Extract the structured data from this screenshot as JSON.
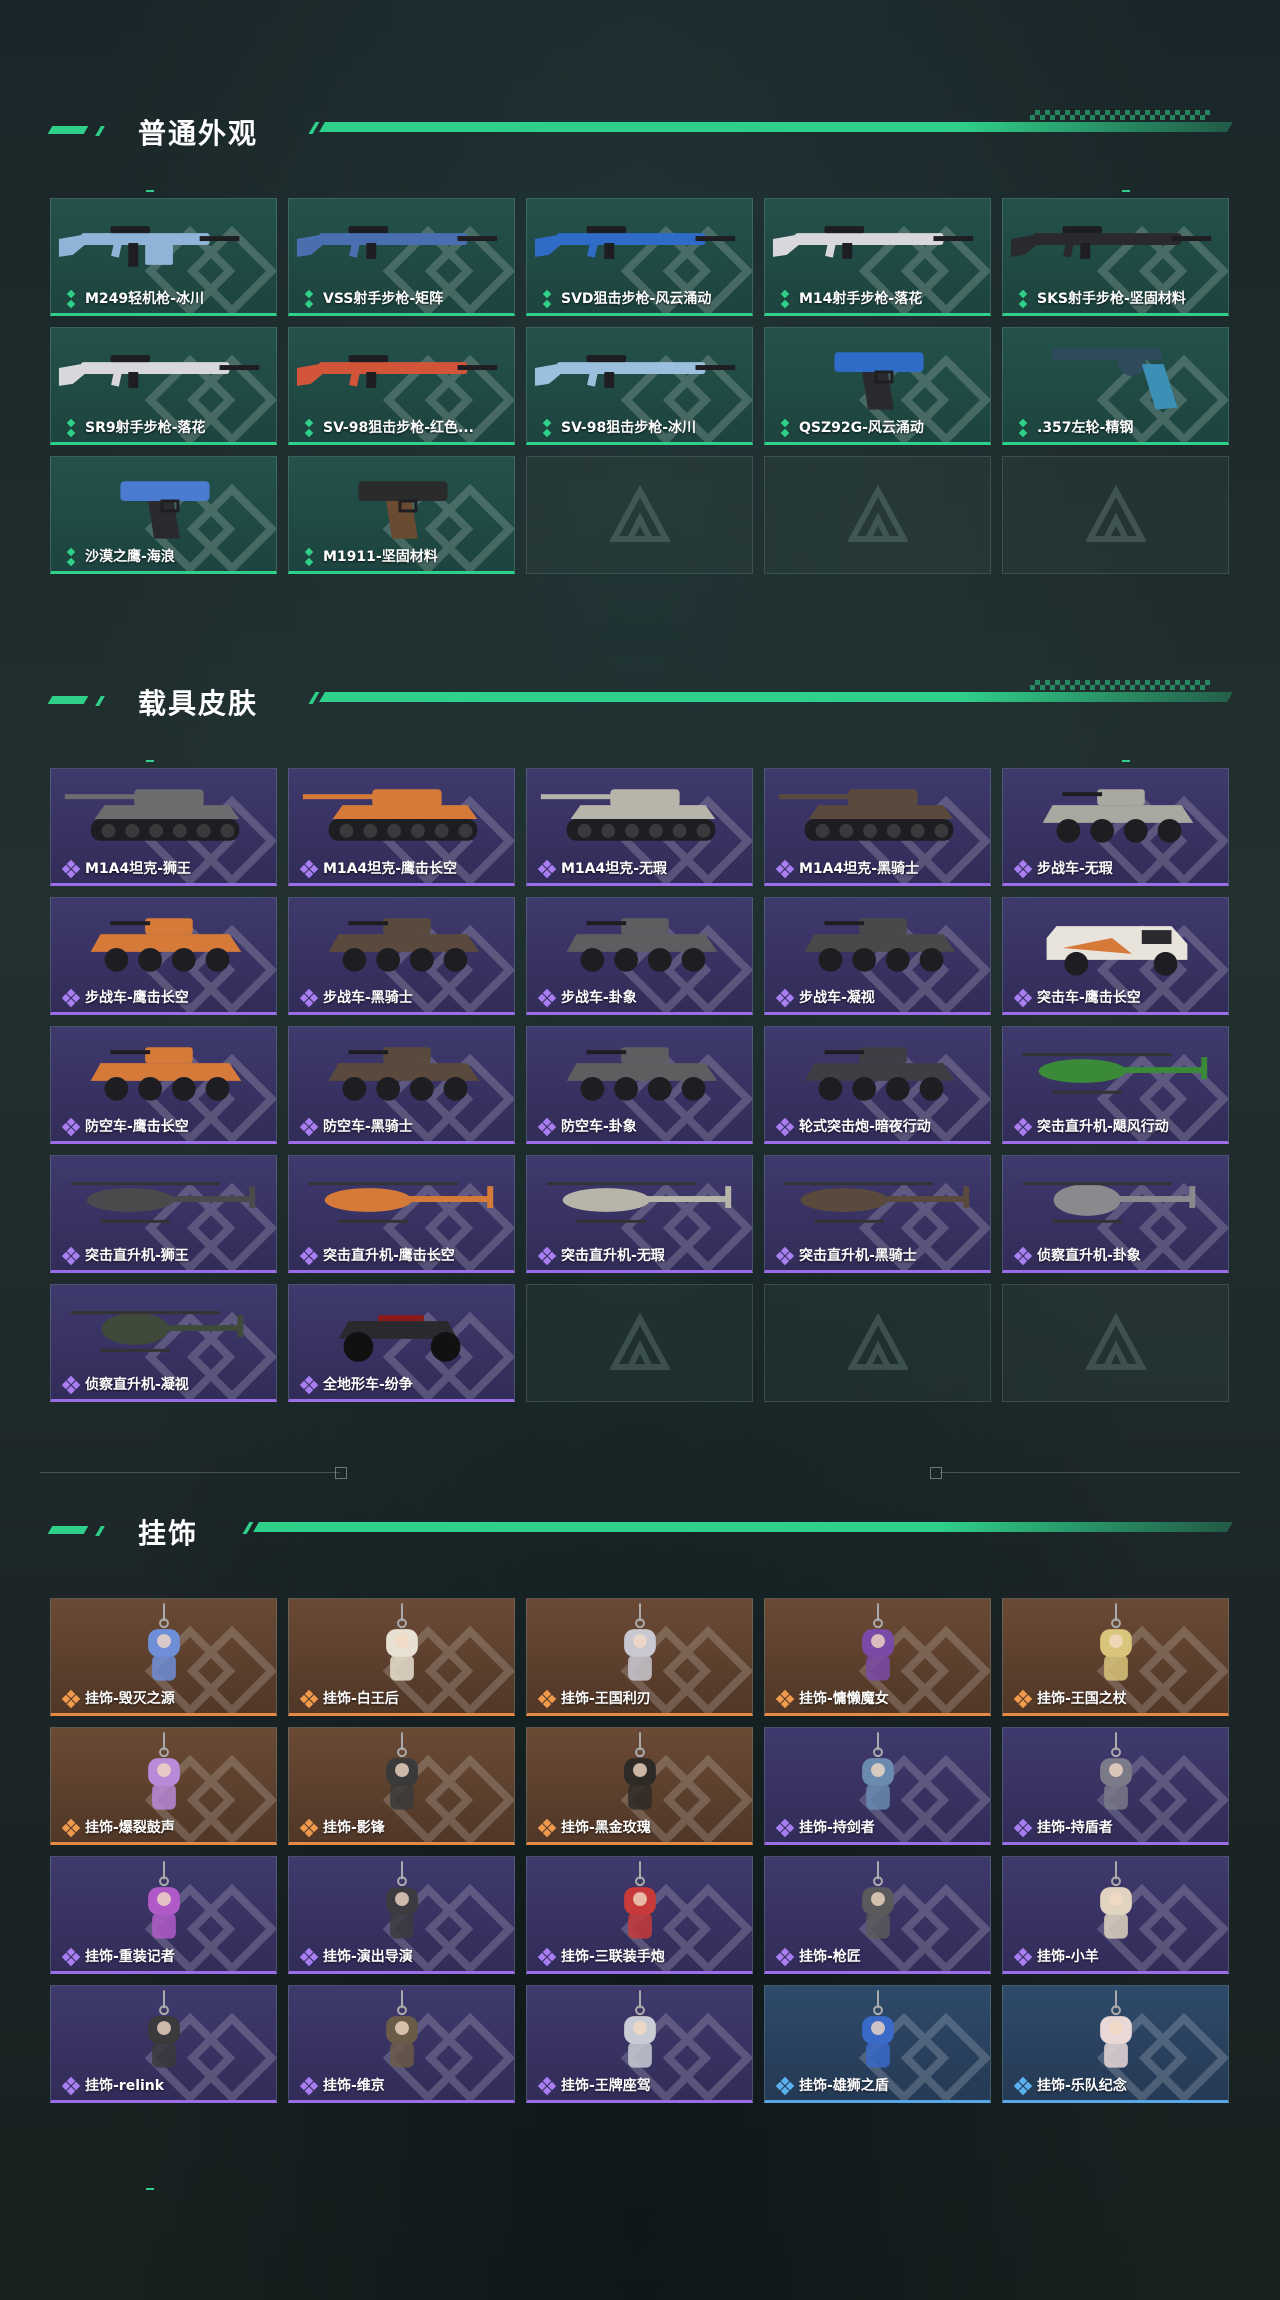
{
  "sections": {
    "weapons": {
      "title": "普通外观",
      "items": [
        {
          "label": "M249轻机枪-冰川",
          "rarity": "green",
          "kind": "rifle-lmg",
          "color": "#8fb4d8"
        },
        {
          "label": "VSS射手步枪-矩阵",
          "rarity": "green",
          "kind": "rifle-vss",
          "color": "#4a6fb0"
        },
        {
          "label": "SVD狙击步枪-风云涌动",
          "rarity": "green",
          "kind": "rifle-long",
          "color": "#2f6cc8"
        },
        {
          "label": "M14射手步枪-落花",
          "rarity": "green",
          "kind": "rifle-long",
          "color": "#d8d8dc"
        },
        {
          "label": "SKS射手步枪-坚固材料",
          "rarity": "green",
          "kind": "rifle-long",
          "color": "#2a2a2e"
        },
        {
          "label": "SR9射手步枪-落花",
          "rarity": "green",
          "kind": "rifle-bullpup",
          "color": "#d8d8dc"
        },
        {
          "label": "SV-98狙击步枪-红色...",
          "rarity": "green",
          "kind": "rifle-long",
          "color": "#d2553a"
        },
        {
          "label": "SV-98狙击步枪-冰川",
          "rarity": "green",
          "kind": "rifle-long",
          "color": "#9bc0de"
        },
        {
          "label": "QSZ92G-风云涌动",
          "rarity": "green",
          "kind": "pistol",
          "color": "#2f6cc8"
        },
        {
          "label": ".357左轮-精钢",
          "rarity": "green",
          "kind": "revolver",
          "color": "#3c8fb5"
        },
        {
          "label": "沙漠之鹰-海浪",
          "rarity": "green",
          "kind": "pistol",
          "color": "#4a7bd0"
        },
        {
          "label": "M1911-坚固材料",
          "rarity": "green",
          "kind": "pistol",
          "color": "#2b2b2b"
        },
        {
          "empty": true
        },
        {
          "empty": true
        },
        {
          "empty": true
        }
      ]
    },
    "vehicles": {
      "title": "载具皮肤",
      "items": [
        {
          "label": "M1A4坦克-狮王",
          "rarity": "purple",
          "kind": "tank",
          "color": "#6c6c6e"
        },
        {
          "label": "M1A4坦克-鹰击长空",
          "rarity": "purple",
          "kind": "tank",
          "color": "#d67a3a"
        },
        {
          "label": "M1A4坦克-无瑕",
          "rarity": "purple",
          "kind": "tank",
          "color": "#b7b4aa"
        },
        {
          "label": "M1A4坦克-黑骑士",
          "rarity": "purple",
          "kind": "tank",
          "color": "#5a4a3e"
        },
        {
          "label": "步战车-无瑕",
          "rarity": "purple",
          "kind": "apc",
          "color": "#a9a8a0"
        },
        {
          "label": "步战车-鹰击长空",
          "rarity": "purple",
          "kind": "apc",
          "color": "#d67a3a"
        },
        {
          "label": "步战车-黑骑士",
          "rarity": "purple",
          "kind": "apc",
          "color": "#5a4a3e"
        },
        {
          "label": "步战车-卦象",
          "rarity": "purple",
          "kind": "apc",
          "color": "#5e5e60"
        },
        {
          "label": "步战车-凝视",
          "rarity": "purple",
          "kind": "apc",
          "color": "#4a4848"
        },
        {
          "label": "突击车-鹰击长空",
          "rarity": "purple",
          "kind": "truck",
          "color": "#e8e4dc"
        },
        {
          "label": "防空车-鹰击长空",
          "rarity": "purple",
          "kind": "apc",
          "color": "#d67a3a"
        },
        {
          "label": "防空车-黑骑士",
          "rarity": "purple",
          "kind": "apc",
          "color": "#5a4a3e"
        },
        {
          "label": "防空车-卦象",
          "rarity": "purple",
          "kind": "apc",
          "color": "#5e5e60"
        },
        {
          "label": "轮式突击炮-暗夜行动",
          "rarity": "purple",
          "kind": "apc",
          "color": "#3e3e44"
        },
        {
          "label": "突击直升机-飓风行动",
          "rarity": "purple",
          "kind": "heli",
          "color": "#3a8a3a"
        },
        {
          "label": "突击直升机-狮王",
          "rarity": "purple",
          "kind": "heli",
          "color": "#4a4a4c"
        },
        {
          "label": "突击直升机-鹰击长空",
          "rarity": "purple",
          "kind": "heli",
          "color": "#d67a3a"
        },
        {
          "label": "突击直升机-无瑕",
          "rarity": "purple",
          "kind": "heli",
          "color": "#b7b4aa"
        },
        {
          "label": "突击直升机-黑骑士",
          "rarity": "purple",
          "kind": "heli",
          "color": "#5a4a3e"
        },
        {
          "label": "侦察直升机-卦象",
          "rarity": "purple",
          "kind": "heli-small",
          "color": "#8a8a8e"
        },
        {
          "label": "侦察直升机-凝视",
          "rarity": "purple",
          "kind": "heli-small",
          "color": "#3f4a3a"
        },
        {
          "label": "全地形车-纷争",
          "rarity": "purple",
          "kind": "atv",
          "color": "#2a2a2e"
        },
        {
          "empty": true
        },
        {
          "empty": true
        },
        {
          "empty": true
        }
      ]
    },
    "charms": {
      "title": "挂饰",
      "items": [
        {
          "label": "挂饰-毁灭之源",
          "rarity": "orange",
          "kind": "charm",
          "color": "#6f8ed8"
        },
        {
          "label": "挂饰-白王后",
          "rarity": "orange",
          "kind": "charm",
          "color": "#e8e0d0"
        },
        {
          "label": "挂饰-王国利刃",
          "rarity": "orange",
          "kind": "charm",
          "color": "#c8c8d0"
        },
        {
          "label": "挂饰-慵懒魔女",
          "rarity": "orange",
          "kind": "charm",
          "color": "#7a4aa8"
        },
        {
          "label": "挂饰-王国之杖",
          "rarity": "orange",
          "kind": "charm",
          "color": "#d8c47a"
        },
        {
          "label": "挂饰-爆裂鼓声",
          "rarity": "orange",
          "kind": "charm",
          "color": "#b88ad8"
        },
        {
          "label": "挂饰-影锋",
          "rarity": "orange",
          "kind": "charm",
          "color": "#3a3a3a"
        },
        {
          "label": "挂饰-黑金玫瑰",
          "rarity": "orange",
          "kind": "charm",
          "color": "#2e2a26"
        },
        {
          "label": "挂饰-持剑者",
          "rarity": "purple",
          "kind": "charm",
          "color": "#6a8ab0"
        },
        {
          "label": "挂饰-持盾者",
          "rarity": "purple",
          "kind": "charm",
          "color": "#7a7a88"
        },
        {
          "label": "挂饰-重装记者",
          "rarity": "purple",
          "kind": "charm",
          "color": "#b05ac8"
        },
        {
          "label": "挂饰-演出导演",
          "rarity": "purple",
          "kind": "charm",
          "color": "#3c3c40"
        },
        {
          "label": "挂饰-三联装手炮",
          "rarity": "purple",
          "kind": "charm",
          "color": "#c83a3a"
        },
        {
          "label": "挂饰-枪匠",
          "rarity": "purple",
          "kind": "charm",
          "color": "#5a5a5c"
        },
        {
          "label": "挂饰-小羊",
          "rarity": "purple",
          "kind": "charm",
          "color": "#e0d4c0"
        },
        {
          "label": "挂饰-relink",
          "rarity": "purple",
          "kind": "charm",
          "color": "#3a3a3c"
        },
        {
          "label": "挂饰-维京",
          "rarity": "purple",
          "kind": "charm",
          "color": "#6a5a48"
        },
        {
          "label": "挂饰-王牌座驾",
          "rarity": "purple",
          "kind": "charm",
          "color": "#c8ccd4"
        },
        {
          "label": "挂饰-雄狮之盾",
          "rarity": "blue",
          "kind": "charm",
          "color": "#3a6ac8"
        },
        {
          "label": "挂饰-乐队纪念",
          "rarity": "blue",
          "kind": "charm",
          "color": "#e8d8d8"
        }
      ]
    }
  }
}
